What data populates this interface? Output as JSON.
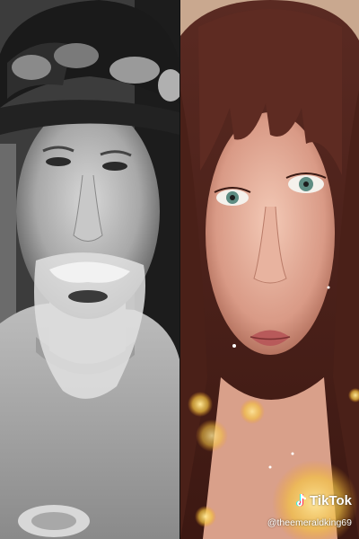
{
  "watermark": {
    "brand": "TikTok",
    "handle": "@theemeraldking69",
    "icon": "tiktok-note-icon"
  },
  "colors": {
    "left_panel_tone": "#7a7a7a",
    "right_panel_tone": "#6a2f28",
    "bokeh": "#f5c542"
  }
}
